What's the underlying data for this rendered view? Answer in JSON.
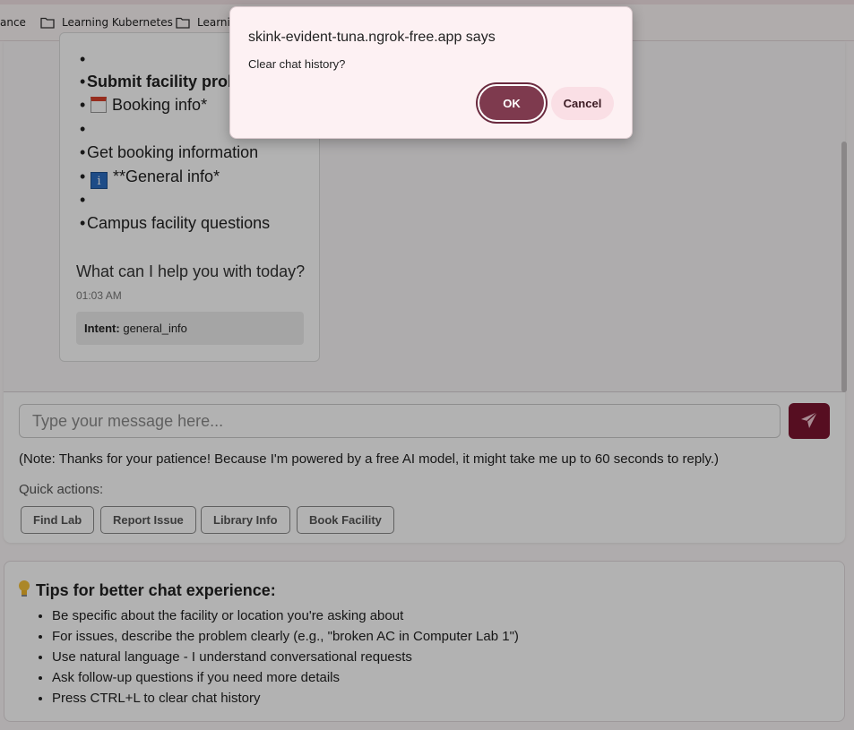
{
  "bookmarks": [
    {
      "label": "ance"
    },
    {
      "label": "Learning Kubernetes"
    },
    {
      "label": "Learnir"
    }
  ],
  "chat": {
    "lines": [
      {
        "text": "Submit facility prob",
        "bold": true
      },
      {
        "text": "Booking info*",
        "icon": "calendar-icon"
      },
      {
        "text": ""
      },
      {
        "text": "Get booking information"
      },
      {
        "text": "**General info*",
        "icon": "info-icon"
      },
      {
        "text": ""
      },
      {
        "text": "Campus facility questions"
      }
    ],
    "question": "What can I help you with today?",
    "time": "01:03 AM",
    "intent_label": "Intent:",
    "intent_value": "general_info"
  },
  "input": {
    "placeholder": "Type your message here...",
    "value": ""
  },
  "note": "(Note: Thanks for your patience! Because I'm powered by a free AI model, it might take me up to 60 seconds to reply.)",
  "quick_actions": {
    "label": "Quick actions:",
    "buttons": [
      "Find Lab",
      "Report Issue",
      "Library Info",
      "Book Facility"
    ]
  },
  "tips": {
    "title": "Tips for better chat experience:",
    "items": [
      "Be specific about the facility or location you're asking about",
      "For issues, describe the problem clearly (e.g., \"broken AC in Computer Lab 1\")",
      "Use natural language - I understand conversational requests",
      "Ask follow-up questions if you need more details",
      "Press CTRL+L to clear chat history"
    ]
  },
  "dialog": {
    "title": "skink-evident-tuna.ngrok-free.app says",
    "message": "Clear chat history?",
    "ok": "OK",
    "cancel": "Cancel"
  },
  "colors": {
    "accent": "#7b1530",
    "dialog_ok": "#7e3a4e",
    "dialog_cancel": "#fadfe5"
  }
}
